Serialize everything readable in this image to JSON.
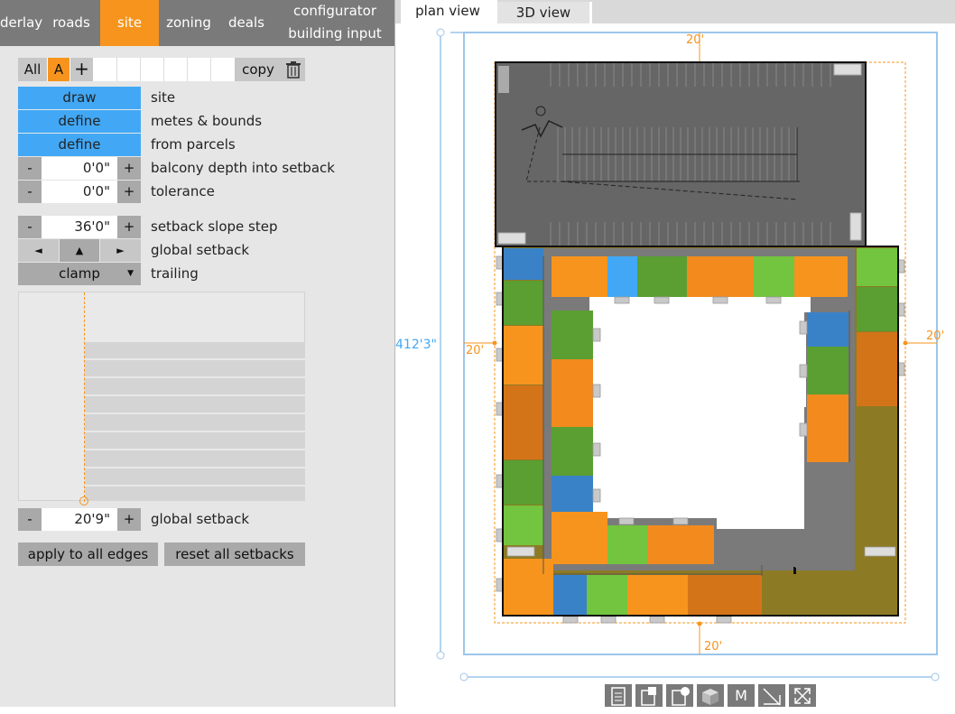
{
  "nav": {
    "items": [
      "derlay",
      "roads",
      "site",
      "zoning",
      "deals"
    ],
    "configurator": "configurator",
    "building_input": "building input"
  },
  "toolbar": {
    "all_label": "All",
    "a_label": "A",
    "add_label": "+",
    "copy_label": "copy"
  },
  "site_actions": [
    {
      "button": "draw",
      "label": "site"
    },
    {
      "button": "define",
      "label": "metes & bounds"
    },
    {
      "button": "define",
      "label": "from parcels"
    }
  ],
  "balcony": {
    "minus": "-",
    "value": "0'0\"",
    "plus": "+",
    "label": "balcony depth into setback"
  },
  "tolerance": {
    "minus": "-",
    "value": "0'0\"",
    "plus": "+",
    "label": "tolerance"
  },
  "slope": {
    "minus": "-",
    "value": "36'0\"",
    "plus": "+",
    "label": "setback slope step"
  },
  "global_setback_row": {
    "left": "◄",
    "up": "▲",
    "right": "►",
    "label": "global setback"
  },
  "trailing": {
    "value": "clamp",
    "caret": "▼",
    "label": "trailing"
  },
  "global_setback": {
    "minus": "-",
    "value": "20'9\"",
    "plus": "+",
    "label": "global setback"
  },
  "actions": {
    "apply": "apply to all edges",
    "reset": "reset all setbacks"
  },
  "tabs": {
    "plan": "plan view",
    "three_d": "3D view"
  },
  "dimensions": {
    "top": "20'",
    "left": "20'",
    "right": "20'",
    "bottom": "20'",
    "height": "412'3\""
  },
  "bottom_toolbar": {
    "m_label": "M"
  },
  "colors": {
    "accent": "#f7941d",
    "blue_button": "#42a8f5",
    "nav_bg": "#7a7a7a",
    "unit_orange": "#f7941d",
    "unit_dark_orange": "#d47418",
    "unit_green": "#5b9e32",
    "unit_light_green": "#73c43e",
    "unit_blue": "#3a82c8",
    "unit_light_blue": "#42a8f5",
    "olive": "#8d7a24",
    "garage": "#666666"
  }
}
